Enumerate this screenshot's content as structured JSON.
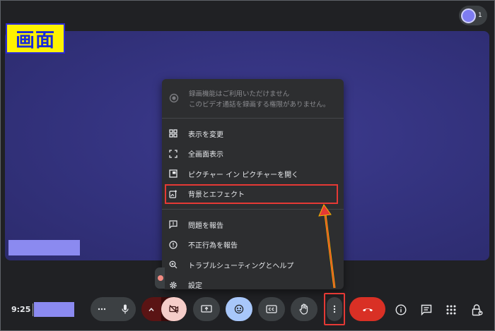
{
  "participants": {
    "count": "1"
  },
  "annotation": {
    "label": "画面"
  },
  "menu": {
    "recording": {
      "title": "録画機能はご利用いただけません",
      "subtitle": "このビデオ通話を録画する権限がありません。"
    },
    "items": [
      {
        "label": "表示を変更",
        "icon": "layout-icon"
      },
      {
        "label": "全画面表示",
        "icon": "fullscreen-icon"
      },
      {
        "label": "ピクチャー イン ピクチャーを開く",
        "icon": "picture-in-picture-icon"
      },
      {
        "label": "背景とエフェクト",
        "icon": "effects-icon"
      },
      {
        "label": "問題を報告",
        "icon": "feedback-icon"
      },
      {
        "label": "不正行為を報告",
        "icon": "report-abuse-icon"
      },
      {
        "label": "トラブルシューティングとヘルプ",
        "icon": "troubleshoot-icon"
      },
      {
        "label": "設定",
        "icon": "settings-icon"
      }
    ]
  },
  "bottom": {
    "time": "9:25"
  },
  "colors": {
    "stage": "#33327d",
    "highlight": "#e53935",
    "leave": "#d93025",
    "emoji_active": "#a8c7fa",
    "annotation_bg": "#fff200",
    "annotation_text": "#1a2bd8"
  }
}
